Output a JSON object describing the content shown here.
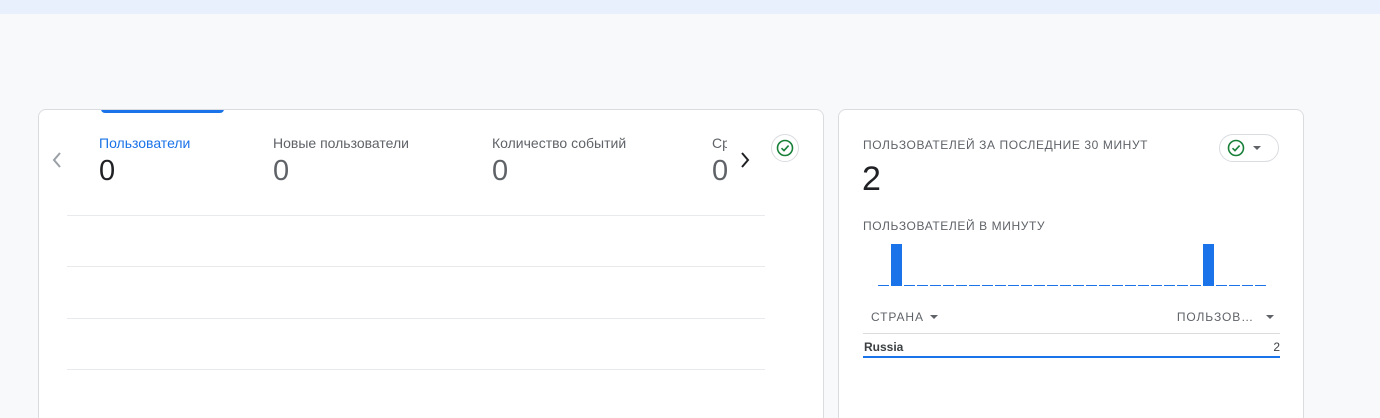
{
  "overview": {
    "metrics": [
      {
        "label": "Пользователи",
        "value": "0",
        "active": true
      },
      {
        "label": "Новые пользователи",
        "value": "0",
        "active": false
      },
      {
        "label": "Количество событий",
        "value": "0",
        "active": false
      },
      {
        "label": "Ср",
        "value": "0",
        "active": false
      }
    ]
  },
  "realtime": {
    "title": "ПОЛЬЗОВАТЕЛЕЙ ЗА ПОСЛЕДНИЕ 30 МИНУТ",
    "value": "2",
    "per_minute_label": "ПОЛЬЗОВАТЕЛЕЙ В МИНУТУ",
    "per_minute_values": [
      0,
      1,
      0,
      0,
      0,
      0,
      0,
      0,
      0,
      0,
      0,
      0,
      0,
      0,
      0,
      0,
      0,
      0,
      0,
      0,
      0,
      0,
      0,
      0,
      0,
      1,
      0,
      0,
      0,
      0
    ],
    "table": {
      "columns": [
        "СТРАНА",
        "ПОЛЬЗОВ…"
      ],
      "rows": [
        {
          "country": "Russia",
          "users": "2"
        }
      ]
    }
  },
  "colors": {
    "accent": "#1a73e8",
    "check": "#188038"
  },
  "icons": [
    "chevron-left-icon",
    "chevron-right-icon",
    "check-circle-icon",
    "caret-down-icon"
  ]
}
